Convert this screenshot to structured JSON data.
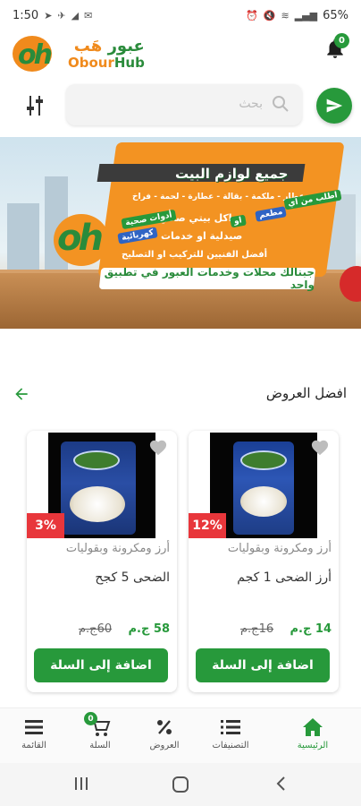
{
  "status_bar": {
    "time": "1:50",
    "battery": "65%",
    "indicators": [
      "navigation-icon",
      "telegram-icon",
      "signal-icon",
      "mail-icon",
      "alarm-icon",
      "mute-icon",
      "volte-icon",
      "wifi-icon",
      "signal-bars-icon",
      "battery-icon"
    ]
  },
  "header": {
    "logo_ar_1": "عبور",
    "logo_ar_2": "هَب",
    "logo_en_1": "Obour",
    "logo_en_2": "Hub",
    "logo_mark": "oh",
    "notification_count": "0"
  },
  "search": {
    "placeholder": "بحث"
  },
  "banner": {
    "title": "جميع لوازم البيت",
    "line1": "عطار - ملكمة - بقالة - عطارة - لحمة - فراخ",
    "line2": "اكل بيتي صحي",
    "line3": "صيدلية او خدمات",
    "line4": "أفضل الفنيين للتركيب او التصليح",
    "tag_order": "اطلب من اي",
    "tag_restaurant": "مطعم",
    "tag_or": "او",
    "tag_tools": "أدوات صحية",
    "tag_electric": "كهربائية",
    "bottom_text": "جبنالك محلات وخدمات العبور في تطبيق واحد"
  },
  "section": {
    "title": "افضل العروض"
  },
  "products": [
    {
      "discount": "12%",
      "category": "أرز ومكرونة وبقوليات",
      "name": "أرز الضحى 1 كجم",
      "price": "14 ج.م",
      "old_price": "16ج.م",
      "add_label": "اضافة إلى السلة"
    },
    {
      "discount": "3%",
      "category": "أرز ومكرونة وبقوليات",
      "name": "الضحى 5 كجح",
      "price": "58 ج.م",
      "old_price": "60ج.م",
      "add_label": "اضافة إلى السلة"
    }
  ],
  "bottom_nav": {
    "home": "الرئيسية",
    "categories": "التصنيفات",
    "offers": "العروض",
    "cart": "السلة",
    "cart_count": "0",
    "menu": "القائمة"
  },
  "colors": {
    "brand_green": "#27993b",
    "brand_orange": "#f08a1c",
    "discount_red": "#e8363b"
  }
}
